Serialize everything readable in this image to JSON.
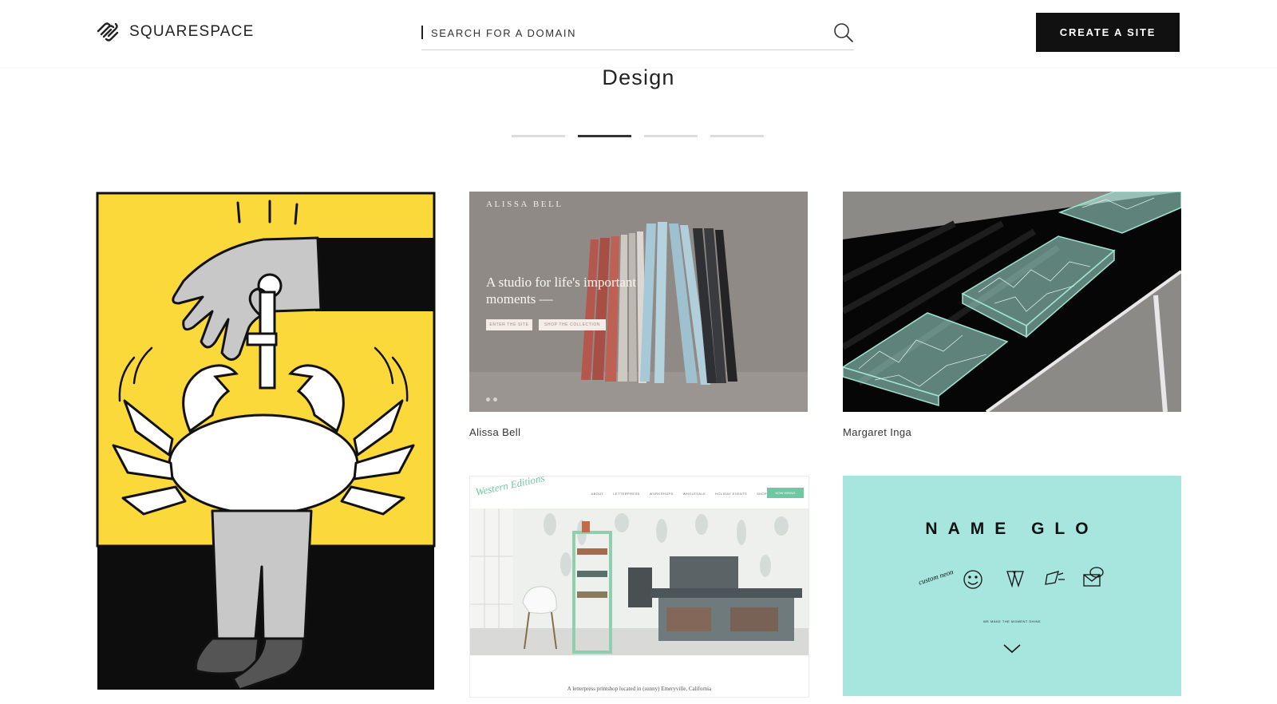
{
  "header": {
    "logo_text": "SQUARESPACE",
    "search_placeholder": "SEARCH FOR A DOMAIN",
    "cta_label": "CREATE A SITE"
  },
  "section": {
    "title": "Design",
    "pager": {
      "count": 4,
      "active_index": 1
    }
  },
  "cards": [
    {
      "caption": ""
    },
    {
      "caption": "Alissa Bell",
      "preview": {
        "brand": "ALISSA BELL",
        "headline": "A studio for life's important moments —",
        "button_1": "ENTER THE SITE",
        "button_2": "SHOP THE COLLECTION"
      }
    },
    {
      "caption": "Margaret Inga"
    },
    {
      "caption": "",
      "preview": {
        "logo": "Western Editions",
        "nav": [
          "ABOUT",
          "LETTERPRESS",
          "WORKSHOPS",
          "WHOLESALE",
          "HOLIDAY EVENTS",
          "SHOP"
        ],
        "nav_button": "NOW HIRING",
        "tagline": "A letterpress printshop located in (sunny) Emeryville, California"
      }
    },
    {
      "caption": "",
      "preview": {
        "title": "NAME GLO",
        "badge": "custom neon",
        "tagline": "WE MAKE THE MOMENT SHINE"
      }
    }
  ],
  "colors": {
    "cta_bg": "#111111",
    "illustration_yellow": "#fcd93a",
    "name_glo_bg": "#a7e6df",
    "western_green": "#6ec8a3"
  },
  "icons": [
    "squarespace-logo-icon",
    "search-icon",
    "chevron-down-icon"
  ]
}
